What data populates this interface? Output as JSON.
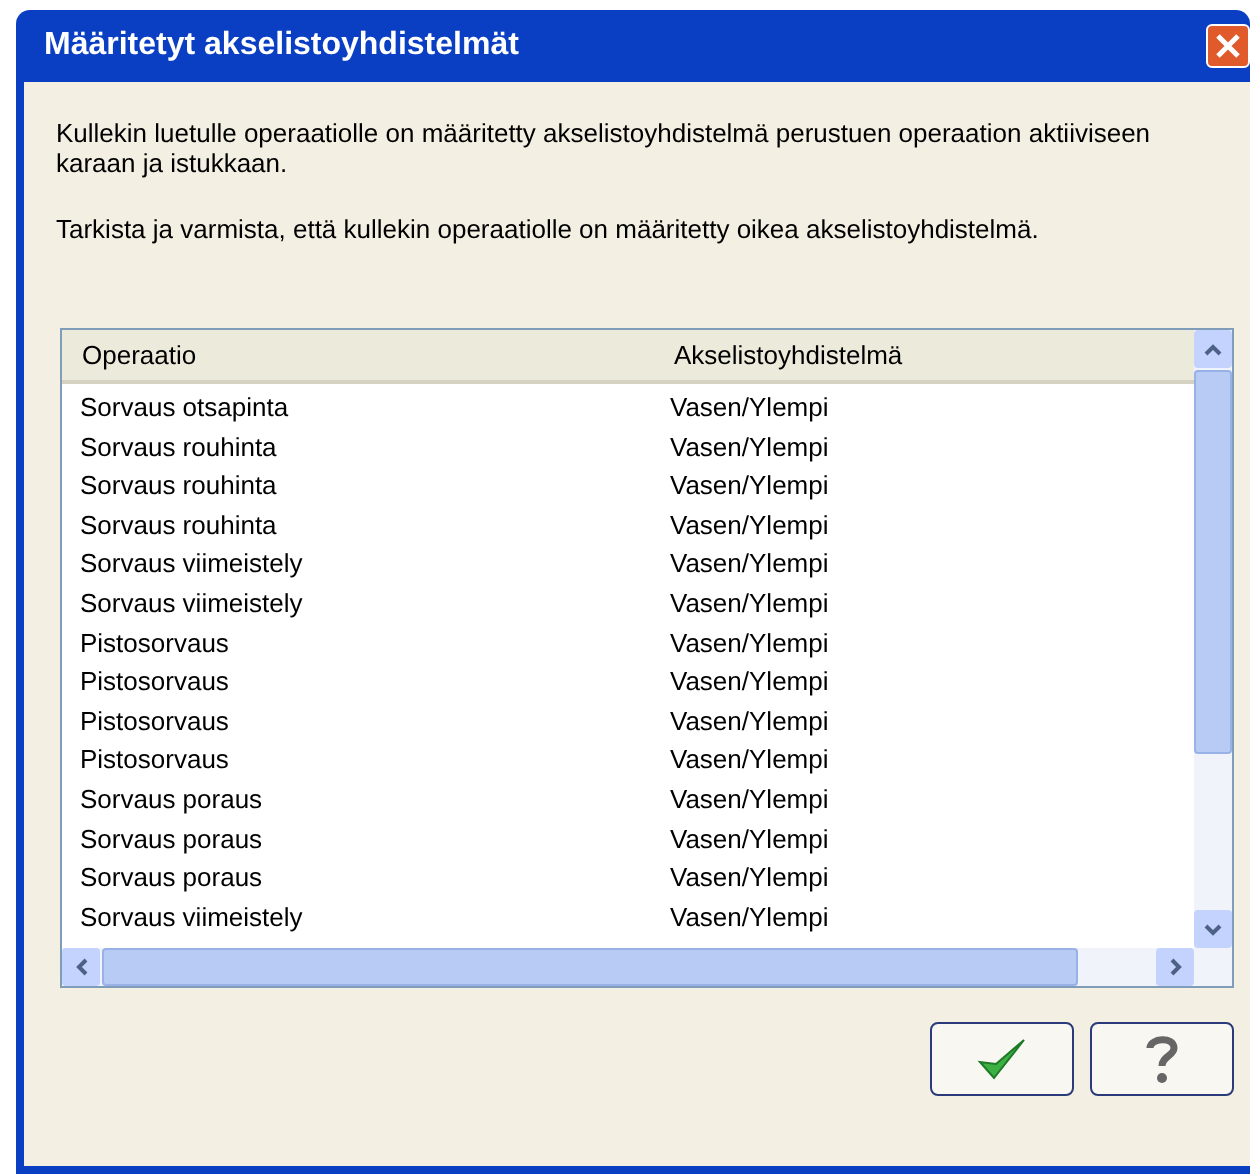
{
  "window": {
    "title": "Määritetyt  akselistoyhdistelmät"
  },
  "description": [
    "Kullekin luetulle operaatiolle on määritetty akselistoyhdistelmä perustuen operaation aktiiviseen karaan ja istukkaan.",
    "Tarkista ja varmista, että kullekin operaatiolle on määritetty oikea akselistoyhdistelmä."
  ],
  "table": {
    "columns": [
      "Operaatio",
      "Akselistoyhdistelmä"
    ],
    "rows": [
      [
        "Sorvaus otsapinta",
        "Vasen/Ylempi"
      ],
      [
        "Sorvaus rouhinta",
        "Vasen/Ylempi"
      ],
      [
        "Sorvaus rouhinta",
        "Vasen/Ylempi"
      ],
      [
        "Sorvaus rouhinta",
        "Vasen/Ylempi"
      ],
      [
        "Sorvaus viimeistely",
        "Vasen/Ylempi"
      ],
      [
        "Sorvaus viimeistely",
        "Vasen/Ylempi"
      ],
      [
        "Pistosorvaus",
        "Vasen/Ylempi"
      ],
      [
        "Pistosorvaus",
        "Vasen/Ylempi"
      ],
      [
        "Pistosorvaus",
        "Vasen/Ylempi"
      ],
      [
        "Pistosorvaus",
        "Vasen/Ylempi"
      ],
      [
        "Sorvaus poraus",
        "Vasen/Ylempi"
      ],
      [
        "Sorvaus poraus",
        "Vasen/Ylempi"
      ],
      [
        "Sorvaus poraus",
        "Vasen/Ylempi"
      ],
      [
        "Sorvaus viimeistely",
        "Vasen/Ylempi"
      ]
    ]
  }
}
